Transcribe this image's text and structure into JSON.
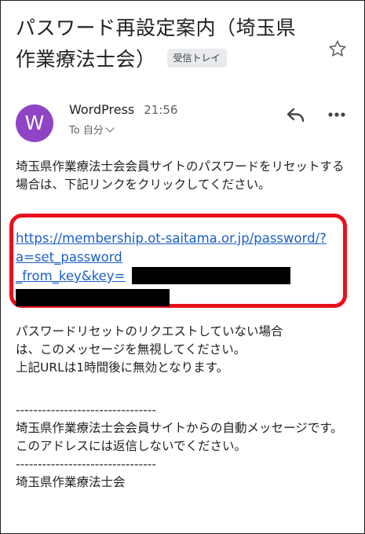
{
  "email": {
    "subject_line1": "パスワード再設定案内（埼玉県",
    "subject_line2": "作業療法士会）",
    "label_badge": "受信トレイ",
    "sender_name": "WordPress",
    "time": "21:56",
    "avatar_letter": "W",
    "to_line": "To 自分",
    "intro": "埼玉県作業療法士会会員サイトのパスワードをリセットする場合は、下記リンクをクリックしてください。",
    "link_line1": "https://membership.ot-saitama.or.jp/password/?",
    "link_line2": "a=set_password",
    "link_line3": "_from_key&key=",
    "notice_line1": "パスワードリセットのリクエストしていない場合",
    "notice_line2": "は、このメッセージを無視してください。",
    "notice_line3": "上記URLは1時間後に無効となります。",
    "separator": "--------------------------------",
    "footer_line1": "埼玉県作業療法士会会員サイトからの自動メッセージです。",
    "footer_line2": "このアドレスには返信しないでください。",
    "footer_line3": "埼玉県作業療法士会"
  },
  "colors": {
    "avatar": "#8e44c4",
    "link": "#1a5fc8",
    "highlight": "#e8101a"
  },
  "icons": {
    "star": "star-icon",
    "reply": "reply-icon",
    "more": "more-vert-icon",
    "chevron": "chevron-down-icon"
  }
}
